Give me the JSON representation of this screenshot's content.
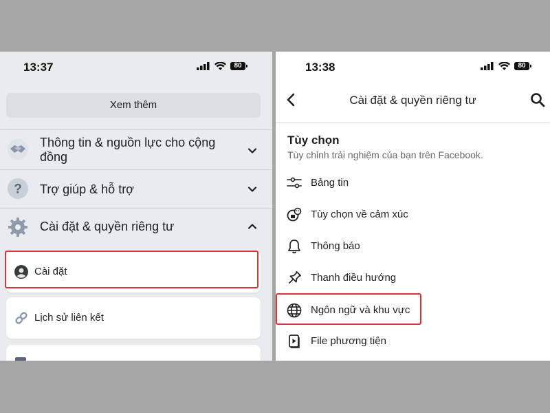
{
  "left": {
    "status": {
      "time": "13:37",
      "battery": "80"
    },
    "see_more_label": "Xem thêm",
    "sections": [
      {
        "label": "Thông tin & nguồn lực cho cộng đồng",
        "icon": "handshake-icon",
        "state": "collapsed"
      },
      {
        "label": "Trợ giúp & hỗ trợ",
        "icon": "help-icon",
        "state": "collapsed"
      },
      {
        "label": "Cài đặt & quyền riêng tư",
        "icon": "gear-icon",
        "state": "expanded"
      }
    ],
    "cards": [
      {
        "label": "Cài đặt",
        "icon": "user-circle-icon",
        "highlighted": true
      },
      {
        "label": "Lịch sử liên kết",
        "icon": "link-icon",
        "highlighted": false
      }
    ]
  },
  "right": {
    "status": {
      "time": "13:38",
      "battery": "80"
    },
    "nav_title": "Cài đặt & quyền riêng tư",
    "section_title": "Tùy chọn",
    "section_subtitle": "Tùy chỉnh trải nghiệm của bạn trên Facebook.",
    "items": [
      {
        "label": "Bảng tin",
        "icon": "sliders-icon",
        "highlighted": false
      },
      {
        "label": "Tùy chọn về cảm xúc",
        "icon": "reaction-icon",
        "highlighted": false
      },
      {
        "label": "Thông báo",
        "icon": "bell-icon",
        "highlighted": false
      },
      {
        "label": "Thanh điều hướng",
        "icon": "pin-icon",
        "highlighted": false
      },
      {
        "label": "Ngôn ngữ và khu vực",
        "icon": "globe-icon",
        "highlighted": true
      },
      {
        "label": "File phương tiện",
        "icon": "media-file-icon",
        "highlighted": false
      }
    ]
  },
  "colors": {
    "highlight": "#d8343a",
    "background": "#a6a6a6"
  }
}
